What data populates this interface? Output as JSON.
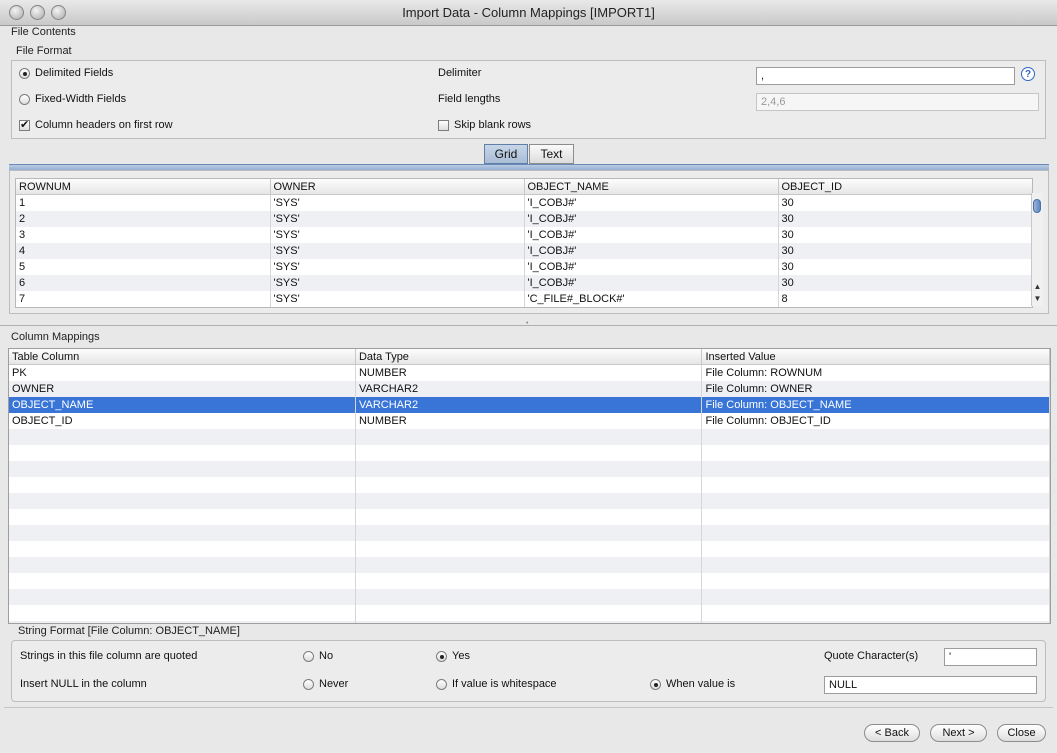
{
  "window": {
    "title": "Import Data - Column Mappings [IMPORT1]"
  },
  "file_contents": {
    "section_label": "File Contents",
    "file_format_label": "File Format",
    "delimited_label": "Delimited Fields",
    "delimited_selected": true,
    "fixed_width_label": "Fixed-Width Fields",
    "fixed_width_selected": false,
    "headers_label": "Column headers on first row",
    "headers_checked": true,
    "delimiter_label": "Delimiter",
    "delimiter_value": ",",
    "field_lengths_label": "Field lengths",
    "field_lengths_value": "2,4,6",
    "skip_blank_label": "Skip blank rows",
    "skip_blank_checked": false,
    "help_icon": "?"
  },
  "tabs": [
    {
      "label": "Grid",
      "active": true
    },
    {
      "label": "Text",
      "active": false
    }
  ],
  "preview": {
    "columns": [
      "ROWNUM",
      "OWNER",
      "OBJECT_NAME",
      "OBJECT_ID"
    ],
    "rows": [
      [
        "1",
        "'SYS'",
        "'I_COBJ#'",
        "30"
      ],
      [
        "2",
        "'SYS'",
        "'I_COBJ#'",
        "30"
      ],
      [
        "3",
        "'SYS'",
        "'I_COBJ#'",
        "30"
      ],
      [
        "4",
        "'SYS'",
        "'I_COBJ#'",
        "30"
      ],
      [
        "5",
        "'SYS'",
        "'I_COBJ#'",
        "30"
      ],
      [
        "6",
        "'SYS'",
        "'I_COBJ#'",
        "30"
      ],
      [
        "7",
        "'SYS'",
        "'C_FILE#_BLOCK#'",
        "8"
      ]
    ]
  },
  "mappings": {
    "section_label": "Column Mappings",
    "columns": [
      "Table Column",
      "Data Type",
      "Inserted Value"
    ],
    "rows": [
      [
        "PK",
        "NUMBER",
        "File Column: ROWNUM"
      ],
      [
        "OWNER",
        "VARCHAR2",
        "File Column: OWNER"
      ],
      [
        "OBJECT_NAME",
        "VARCHAR2",
        "File Column: OBJECT_NAME"
      ],
      [
        "OBJECT_ID",
        "NUMBER",
        "File Column: OBJECT_ID"
      ]
    ],
    "selected_row": 2
  },
  "string_format": {
    "section_label": "String Format [File Column: OBJECT_NAME]",
    "quoted_label": "Strings in this file column are quoted",
    "no_label": "No",
    "yes_label": "Yes",
    "quoted_selection": "Yes",
    "quote_char_label": "Quote Character(s)",
    "quote_char_value": "'",
    "null_label": "Insert NULL in the column",
    "never_label": "Never",
    "whitespace_label": "If value is whitespace",
    "when_value_label": "When value is",
    "null_selection": "When value is",
    "null_value": "NULL"
  },
  "buttons": {
    "back": "< Back",
    "next": "Next >",
    "close": "Close"
  },
  "colors": {
    "selection": "#3875d7",
    "help": "#2f66c7"
  }
}
